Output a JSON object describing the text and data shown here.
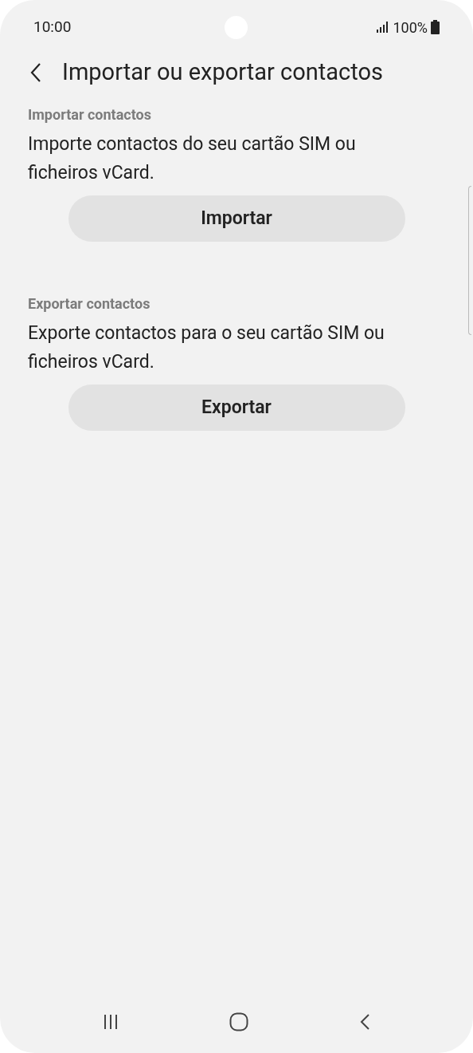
{
  "status_bar": {
    "time": "10:00",
    "battery": "100%"
  },
  "header": {
    "title": "Importar ou exportar contactos"
  },
  "sections": [
    {
      "heading": "Importar contactos",
      "description": "Importe contactos do seu cartão SIM ou ficheiros vCard.",
      "button": "Importar"
    },
    {
      "heading": "Exportar contactos",
      "description": "Exporte contactos para o seu cartão SIM ou ficheiros vCard.",
      "button": "Exportar"
    }
  ]
}
